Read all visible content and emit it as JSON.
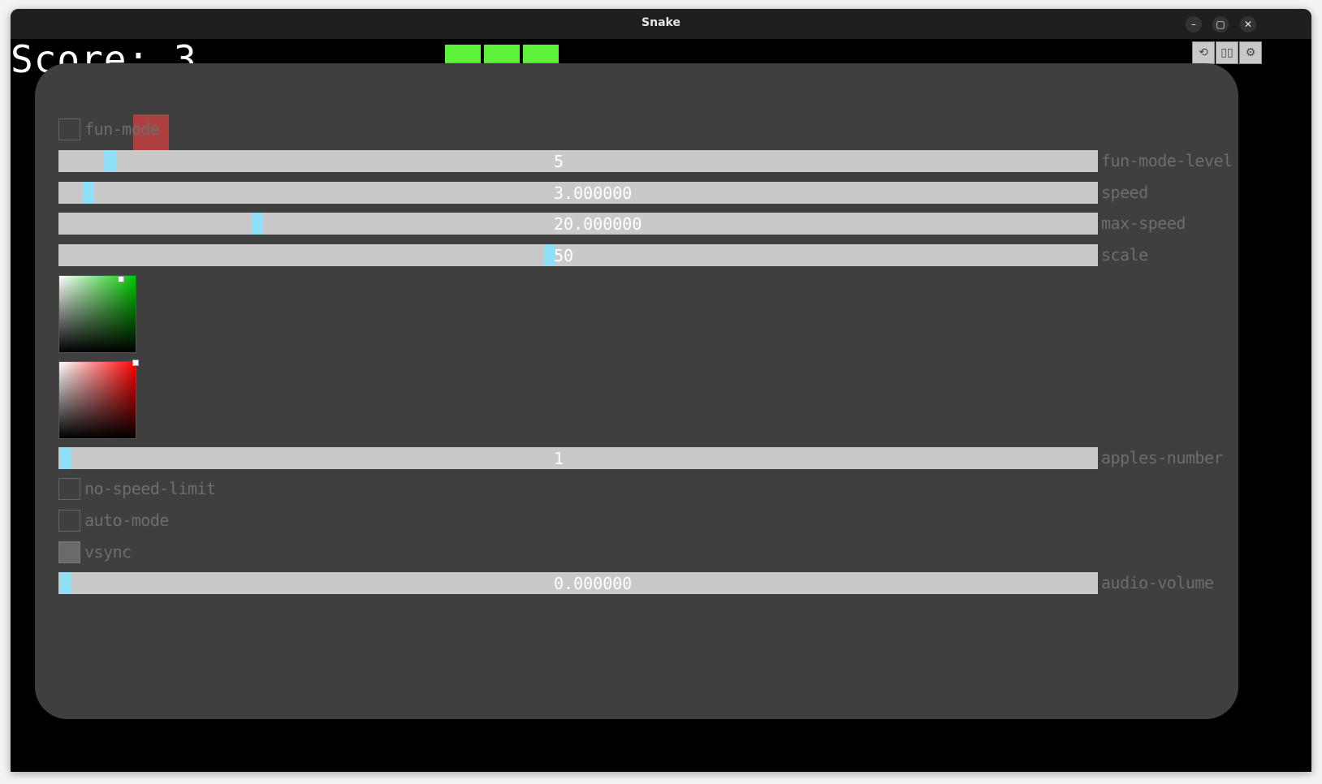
{
  "window": {
    "title": "Snake"
  },
  "game": {
    "score_text": "Score: 3",
    "snake_color": "#5cf23a",
    "apple_color": "#b84040"
  },
  "toolbar": {
    "reset_icon": "reset-icon",
    "pause_icon": "pause-icon",
    "settings_icon": "gear-icon"
  },
  "settings": {
    "fun_mode": {
      "label": "fun-mode",
      "checked": false
    },
    "fun_mode_level": {
      "label": "fun-mode-level",
      "value": "5"
    },
    "speed": {
      "label": "speed",
      "value": "3.000000"
    },
    "max_speed": {
      "label": "max-speed",
      "value": "20.000000"
    },
    "scale": {
      "label": "scale",
      "value": "50"
    },
    "snake_color_picker": {
      "color": "#00ff00"
    },
    "apple_color_picker": {
      "color": "#ff0000"
    },
    "apples_number": {
      "label": "apples-number",
      "value": "1"
    },
    "no_speed_limit": {
      "label": "no-speed-limit",
      "checked": false
    },
    "auto_mode": {
      "label": "auto-mode",
      "checked": false
    },
    "vsync": {
      "label": "vsync",
      "checked": true
    },
    "audio_volume": {
      "label": "audio-volume",
      "value": "0.000000"
    }
  }
}
